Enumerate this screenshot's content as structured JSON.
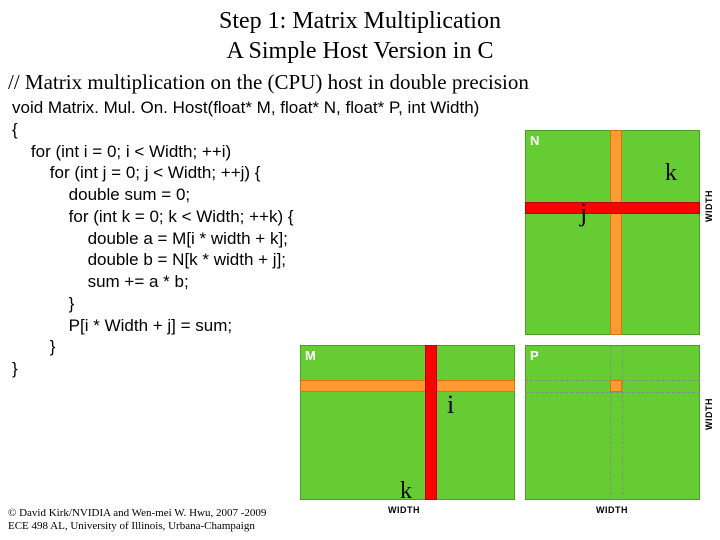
{
  "title_line1": "Step 1: Matrix Multiplication",
  "title_line2": "A Simple Host Version in C",
  "comment": "// Matrix multiplication on the (CPU) host in double precision",
  "code": "void Matrix. Mul. On. Host(float* M, float* N, float* P, int Width)\n{\n    for (int i = 0; i < Width; ++i) \n        for (int j = 0; j < Width; ++j) {\n            double sum = 0;\n            for (int k = 0; k < Width; ++k) {\n                double a = M[i * width + k];\n                double b = N[k * width + j];\n                sum += a * b;\n            }\n            P[i * Width + j] = sum;\n        }\n}",
  "diagram": {
    "mat_n": "N",
    "mat_m": "M",
    "mat_p": "P",
    "k": "k",
    "j": "j",
    "i": "i",
    "width": "WIDTH"
  },
  "footer_line1": "© David Kirk/NVIDIA and Wen-mei W. Hwu, 2007 -2009",
  "footer_line2": "ECE 498 AL, University of Illinois, Urbana-Champaign"
}
